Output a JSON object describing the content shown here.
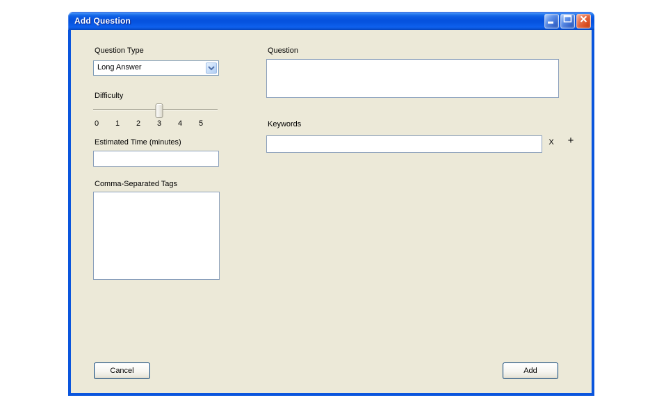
{
  "window": {
    "title": "Add Question"
  },
  "form": {
    "question_type": {
      "label": "Question Type",
      "value": "Long Answer"
    },
    "difficulty": {
      "label": "Difficulty",
      "min": 0,
      "max": 5,
      "value": 3,
      "ticks": [
        "0",
        "1",
        "2",
        "3",
        "4",
        "5"
      ]
    },
    "estimated_time": {
      "label": "Estimated Time (minutes)",
      "value": ""
    },
    "tags": {
      "label": "Comma-Separated Tags",
      "value": ""
    },
    "question": {
      "label": "Question",
      "value": ""
    },
    "keywords": {
      "label": "Keywords",
      "value": "",
      "remove_button": "X",
      "add_button": "+"
    },
    "buttons": {
      "cancel": "Cancel",
      "add": "Add"
    }
  },
  "colors": {
    "titlebar_blue": "#0754E0",
    "frame_blue": "#0A55DD",
    "client_bg": "#ECE9D8",
    "close_button_red": "#D84A1D",
    "control_button_blue": "#3767CC",
    "input_border": "#8BA0BC",
    "button_border": "#003C74"
  }
}
